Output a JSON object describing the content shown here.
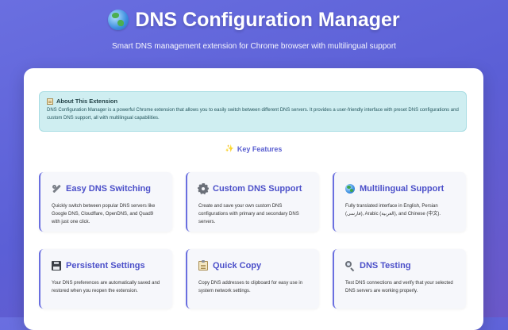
{
  "header": {
    "title": "DNS Configuration Manager",
    "subtitle": "Smart DNS management extension for Chrome browser with multilingual support",
    "title_icon": "globe-icon"
  },
  "about": {
    "title": "About This Extension",
    "icon": "notepad-icon",
    "text": "DNS Configuration Manager is a powerful Chrome extension that allows you to easily switch between different DNS servers. It provides a user-friendly interface with preset DNS configurations and custom DNS support, all with multilingual capabilities."
  },
  "key_features": {
    "title": "Key Features",
    "icon": "sparkles-icon"
  },
  "features": [
    {
      "title": "Easy DNS Switching",
      "icon": "wrench-icon",
      "description": "Quickly switch between popular DNS servers like Google DNS, Cloudflare, OpenDNS, and Quad9 with just one click."
    },
    {
      "title": "Custom DNS Support",
      "icon": "gear-icon",
      "description": "Create and save your own custom DNS configurations with primary and secondary DNS servers."
    },
    {
      "title": "Multilingual Support",
      "icon": "globe-icon",
      "description": "Fully translated interface in English, Persian (فارسی), Arabic (العربية), and Chinese (中文)."
    },
    {
      "title": "Persistent Settings",
      "icon": "floppy-disk-icon",
      "description": "Your DNS preferences are automatically saved and restored when you reopen the extension."
    },
    {
      "title": "Quick Copy",
      "icon": "clipboard-icon",
      "description": "Copy DNS addresses to clipboard for easy use in system network settings."
    },
    {
      "title": "DNS Testing",
      "icon": "magnifier-icon",
      "description": "Test DNS connections and verify that your selected DNS servers are working properly."
    }
  ],
  "colors": {
    "background_gradient_start": "#6a6fe0",
    "background_gradient_end": "#6a58c8",
    "accent": "#4b4fc9",
    "about_background": "#cfeef1"
  }
}
